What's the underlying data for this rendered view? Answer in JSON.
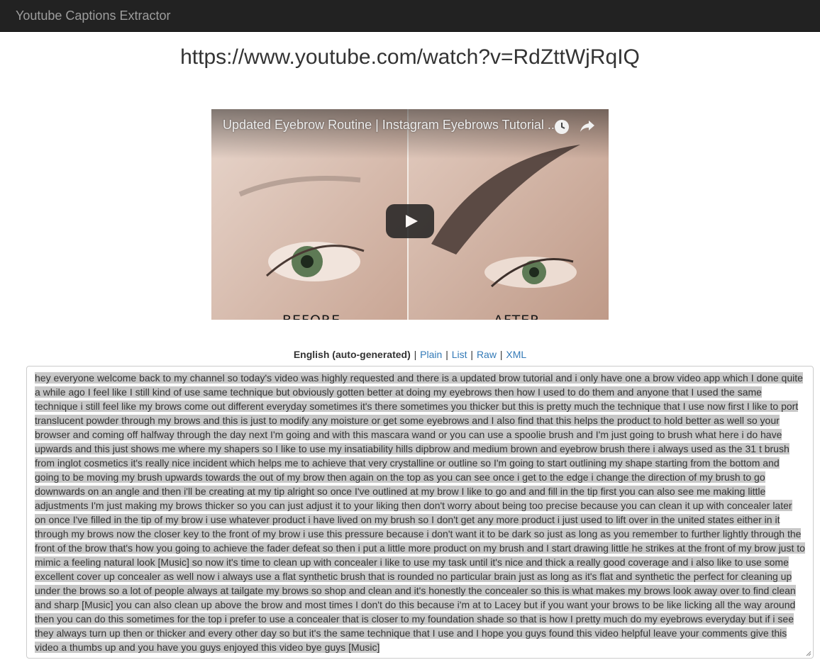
{
  "navbar": {
    "brand": "Youtube Captions Extractor"
  },
  "video": {
    "url": "https://www.youtube.com/watch?v=RdZttWjRqIQ",
    "title": "Updated Eyebrow Routine | Instagram Eyebrows Tutorial ...",
    "label_before": "BEFORE",
    "label_after": "AFTER",
    "icons": {
      "watch_later": "clock-icon",
      "share": "share-icon",
      "play": "play-icon"
    }
  },
  "formats": {
    "language": "English (auto-generated)",
    "links": [
      "Plain",
      "List",
      "Raw",
      "XML"
    ],
    "separator": "|"
  },
  "captions": {
    "text": "hey everyone welcome back to my channel so today's video was highly requested and there is a updated brow tutorial and i only have one a brow video app which I done quite a while ago I feel like I still kind of use same technique but obviously gotten better at doing my eyebrows then how I used to do them and anyone that I used the same technique i still feel like my brows come out different everyday sometimes it's there sometimes you thicker but this is pretty much the technique that I use now first I like to port translucent powder through my brows and this is just to modify any moisture or get some eyebrows and I also find that this helps the product to hold better as well so your browser and coming off halfway through the day next I'm going and with this mascara wand or you can use a spoolie brush and I'm just going to brush what here i do have upwards and this just shows me where my shapers so I like to use my insatiability hills dipbrow and medium brown and eyebrow brush there i always used as the 31 t brush from inglot cosmetics it's really nice incident which helps me to achieve that very crystalline or outline so I'm going to start outlining my shape starting from the bottom and going to be moving my brush upwards towards the out of my brow then again on the top as you can see once i get to the edge i change the direction of my brush to go downwards on an angle and then i'll be creating at my tip alright so once I've outlined at my brow I like to go and and fill in the tip first you can also see me making little adjustments I'm just making my brows thicker so you can just adjust it to your liking then don't worry about being too precise because you can clean it up with concealer later on once I've filled in the tip of my brow i use whatever product i have lived on my brush so I don't get any more product i just used to lift over in the united states either in it through my brows now the closer key to the front of my brow i use this pressure because i don't want it to be dark so just as long as you remember to further lightly through the front of the brow that's how you going to achieve the fader defeat so then i put a little more product on my brush and I start drawing little he strikes at the front of my brow just to mimic a feeling natural look [Music] so now it's time to clean up with concealer i like to use my task until it's nice and thick a really good coverage and i also like to use some excellent cover up concealer as well now i always use a flat synthetic brush that is rounded no particular brain just as long as it's flat and synthetic the perfect for cleaning up under the brows so a lot of people always at tailgate my brows so shop and clean and it's honestly the concealer so this is what makes my brows look away over to find clean and sharp [Music] you can also clean up above the brow and most times I don't do this because i'm at to Lacey but if you want your brows to be like licking all the way around then you can do this sometimes for the top i prefer to use a concealer that is closer to my foundation shade so that is how I pretty much do my eyebrows everyday but if i see they always turn up then or thicker and every other day so but it's the same technique that I use and I hope you guys found this video helpful leave your comments give this video a thumbs up and you have you guys enjoyed this video bye guys [Music]"
  },
  "colors": {
    "navbar": "#222222",
    "link": "#337ab7",
    "selection": "#c8c8c8"
  }
}
